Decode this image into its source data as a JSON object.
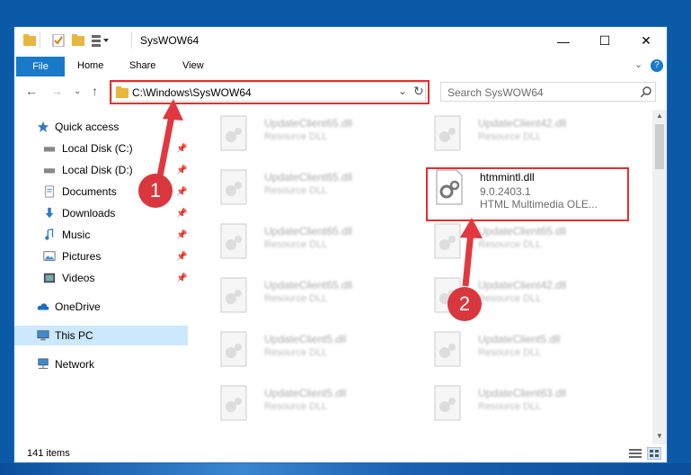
{
  "window": {
    "title": "SysWOW64"
  },
  "window_controls": {
    "minimize": "—",
    "maximize": "☐",
    "close": "✕"
  },
  "ribbon": {
    "tabs": [
      "File",
      "Home",
      "Share",
      "View"
    ],
    "collapse": "⌄",
    "help": "?"
  },
  "navigation": {
    "back": "←",
    "forward": "→",
    "recent": "⌄",
    "up": "↑",
    "address": "C:\\Windows\\SysWOW64",
    "dropdown": "⌄",
    "refresh": "↻",
    "search_placeholder": "Search SysWOW64"
  },
  "sidebar": {
    "items": [
      {
        "label": "Quick access",
        "icon": "star-icon",
        "pinned": false
      },
      {
        "label": "Local Disk (C:)",
        "icon": "drive-icon",
        "pinned": true
      },
      {
        "label": "Local Disk (D:)",
        "icon": "drive-icon",
        "pinned": true
      },
      {
        "label": "Documents",
        "icon": "documents-icon",
        "pinned": true
      },
      {
        "label": "Downloads",
        "icon": "download-icon",
        "pinned": true
      },
      {
        "label": "Music",
        "icon": "music-icon",
        "pinned": true
      },
      {
        "label": "Pictures",
        "icon": "pictures-icon",
        "pinned": true
      },
      {
        "label": "Videos",
        "icon": "videos-icon",
        "pinned": true
      },
      {
        "label": "OneDrive",
        "icon": "cloud-icon",
        "pinned": false
      },
      {
        "label": "This PC",
        "icon": "computer-icon",
        "pinned": false
      },
      {
        "label": "Network",
        "icon": "network-icon",
        "pinned": false
      }
    ]
  },
  "files": [
    {
      "name": "UpdateClient65.dll",
      "type": "Resource DLL"
    },
    {
      "name": "UpdateClient42.dll",
      "type": "Resource DLL"
    },
    {
      "name": "UpdateClient65.dll",
      "type": "Resource DLL"
    },
    {
      "name": "htmmintl.dll",
      "version": "9.0.2403.1",
      "desc": "HTML Multimedia OLE...",
      "selected": true
    },
    {
      "name": "UpdateClient65.dll",
      "type": "Resource DLL"
    },
    {
      "name": "UpdateClient65.dll",
      "type": "Resource DLL"
    },
    {
      "name": "UpdateClient65.dll",
      "type": "Resource DLL"
    },
    {
      "name": "UpdateClient42.dll",
      "type": "Resource DLL"
    },
    {
      "name": "UpdateClient5.dll",
      "type": "Resource DLL"
    },
    {
      "name": "UpdateClient5.dll",
      "type": "Resource DLL"
    },
    {
      "name": "UpdateClient5.dll",
      "type": "Resource DLL"
    },
    {
      "name": "UpdateClient63.dll",
      "type": "Resource DLL"
    }
  ],
  "status": {
    "item_count": "141 items"
  },
  "annotations": {
    "badge1": "1",
    "badge2": "2"
  },
  "colors": {
    "accent": "#1979ca",
    "highlight_red": "#e03030",
    "badge_red": "#d9363e",
    "selected_nav": "#cce8ff"
  }
}
